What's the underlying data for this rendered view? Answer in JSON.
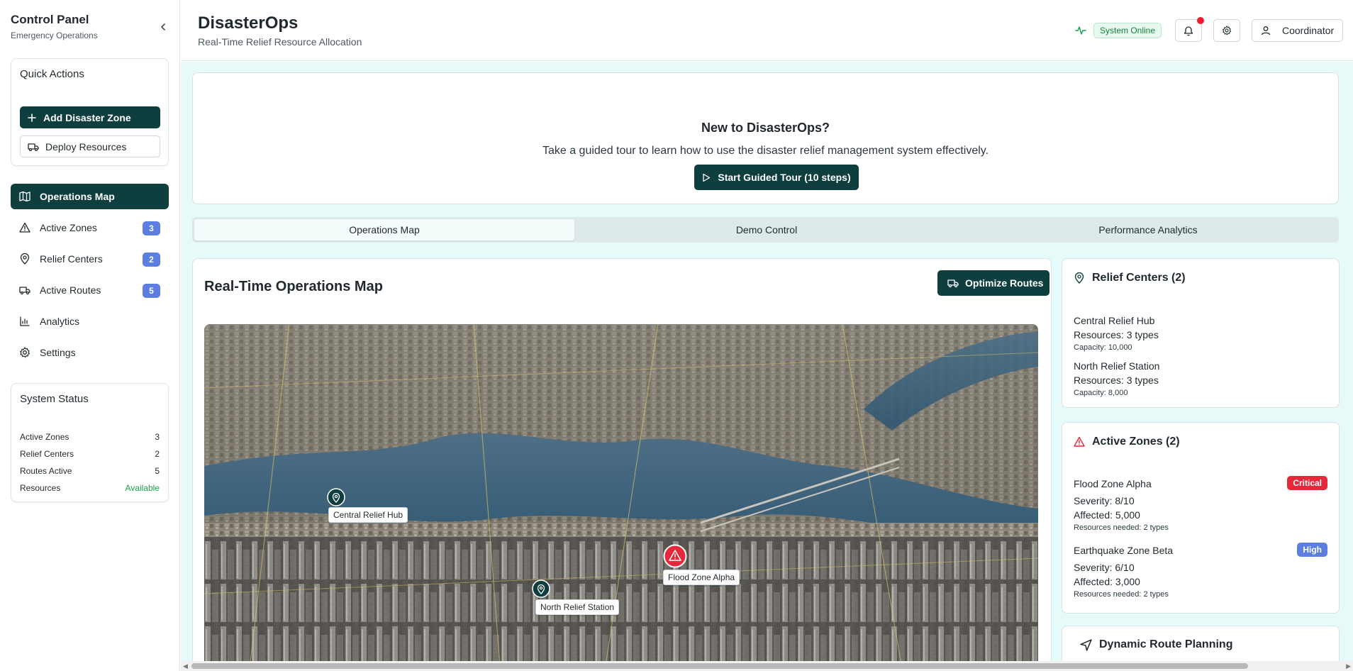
{
  "sidebar": {
    "title": "Control Panel",
    "subtitle": "Emergency Operations",
    "quick_actions": {
      "title": "Quick Actions",
      "add_zone": "Add Disaster Zone",
      "deploy": "Deploy Resources"
    },
    "nav": [
      {
        "label": "Operations Map",
        "icon": "map-icon"
      },
      {
        "label": "Active Zones",
        "icon": "alert-triangle-icon",
        "count": "3"
      },
      {
        "label": "Relief Centers",
        "icon": "map-pin-icon",
        "count": "2"
      },
      {
        "label": "Active Routes",
        "icon": "truck-icon",
        "count": "5"
      },
      {
        "label": "Analytics",
        "icon": "bar-chart-icon"
      },
      {
        "label": "Settings",
        "icon": "gear-icon"
      }
    ],
    "system_status": {
      "title": "System Status",
      "rows": [
        {
          "label": "Active Zones",
          "value": "3"
        },
        {
          "label": "Relief Centers",
          "value": "2"
        },
        {
          "label": "Routes Active",
          "value": "5"
        },
        {
          "label": "Resources",
          "value": "Available"
        }
      ]
    }
  },
  "header": {
    "title": "DisasterOps",
    "subtitle": "Real-Time Relief Resource Allocation",
    "status": "System Online",
    "user": "Coordinator"
  },
  "tour": {
    "title": "New to DisasterOps?",
    "text": "Take a guided tour to learn how to use the disaster relief management system effectively.",
    "button": "Start Guided Tour (10 steps)"
  },
  "tabs": [
    "Operations Map",
    "Demo Control",
    "Performance Analytics"
  ],
  "map": {
    "title": "Real-Time Operations Map",
    "optimize_button": "Optimize Routes",
    "markers": {
      "central": "Central Relief Hub",
      "north": "North Relief Station",
      "flood": "Flood Zone Alpha"
    }
  },
  "relief_centers": {
    "title": "Relief Centers (2)",
    "items": [
      {
        "name": "Central Relief Hub",
        "resources": "Resources: 3 types",
        "capacity": "Capacity: 10,000"
      },
      {
        "name": "North Relief Station",
        "resources": "Resources: 3 types",
        "capacity": "Capacity: 8,000"
      }
    ]
  },
  "active_zones": {
    "title": "Active Zones (2)",
    "items": [
      {
        "name": "Flood Zone Alpha",
        "severity_label": "Critical",
        "severity": "Severity: 8/10",
        "affected": "Affected: 5,000",
        "needed": "Resources needed: 2 types"
      },
      {
        "name": "Earthquake Zone Beta",
        "severity_label": "High",
        "severity": "Severity: 6/10",
        "affected": "Affected: 3,000",
        "needed": "Resources needed: 2 types"
      }
    ]
  },
  "route_planning": {
    "title": "Dynamic Route Planning"
  },
  "colors": {
    "primary": "#0f3e3f",
    "badge": "#5b7ee0",
    "critical": "#e5283a",
    "high": "#5b7ee0",
    "online": "#16a34a",
    "main_bg": "#e6fafa"
  }
}
